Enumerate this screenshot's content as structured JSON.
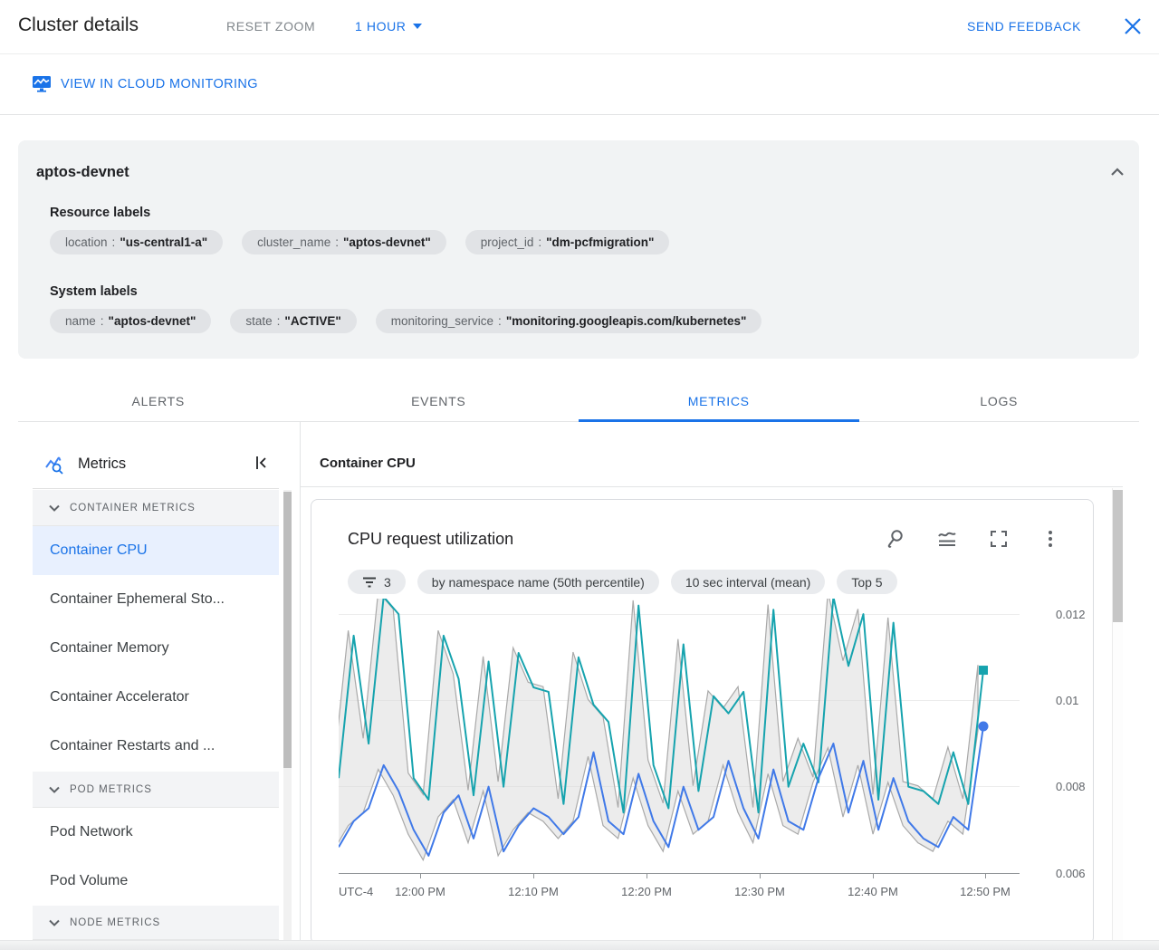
{
  "header": {
    "title": "Cluster details",
    "reset_zoom_label": "RESET ZOOM",
    "time_range_label": "1 HOUR",
    "send_feedback_label": "SEND FEEDBACK"
  },
  "toolbar": {
    "view_in_monitoring_label": "VIEW IN CLOUD MONITORING"
  },
  "cluster_card": {
    "title": "aptos-devnet",
    "resource_labels_title": "Resource labels",
    "resource_labels": [
      {
        "key": "location",
        "value": "\"us-central1-a\""
      },
      {
        "key": "cluster_name",
        "value": "\"aptos-devnet\""
      },
      {
        "key": "project_id",
        "value": "\"dm-pcfmigration\""
      }
    ],
    "system_labels_title": "System labels",
    "system_labels": [
      {
        "key": "name",
        "value": "\"aptos-devnet\""
      },
      {
        "key": "state",
        "value": "\"ACTIVE\""
      },
      {
        "key": "monitoring_service",
        "value": "\"monitoring.googleapis.com/kubernetes\""
      }
    ]
  },
  "tabs": [
    {
      "label": "ALERTS"
    },
    {
      "label": "EVENTS"
    },
    {
      "label": "METRICS"
    },
    {
      "label": "LOGS"
    }
  ],
  "sidebar": {
    "title": "Metrics",
    "sections": [
      {
        "header": "CONTAINER METRICS",
        "items": [
          {
            "label": "Container CPU"
          },
          {
            "label": "Container Ephemeral Sto..."
          },
          {
            "label": "Container Memory"
          },
          {
            "label": "Container Accelerator"
          },
          {
            "label": "Container Restarts and ..."
          }
        ]
      },
      {
        "header": "POD METRICS",
        "items": [
          {
            "label": "Pod Network"
          },
          {
            "label": "Pod Volume"
          }
        ]
      },
      {
        "header": "NODE METRICS",
        "items": []
      }
    ]
  },
  "main": {
    "panel_title": "Container CPU",
    "chart_card": {
      "title": "CPU request utilization",
      "chips": [
        {
          "label": "3",
          "icon": "filter-list-icon"
        },
        {
          "label": "by namespace name (50th percentile)"
        },
        {
          "label": "10 sec interval (mean)"
        },
        {
          "label": "Top 5"
        }
      ]
    }
  },
  "chart_data": {
    "type": "line",
    "title": "CPU request utilization",
    "grid": true,
    "legend_position": "none",
    "x_axis": {
      "timezone_label": "UTC-4",
      "tick_labels": [
        "12:00 PM",
        "12:10 PM",
        "12:20 PM",
        "12:30 PM",
        "12:40 PM",
        "12:50 PM"
      ]
    },
    "y_axis": {
      "tick_labels": [
        "0.012",
        "0.01",
        "0.008",
        "0.006"
      ],
      "tick_values": [
        0.012,
        0.01,
        0.008,
        0.006
      ],
      "range": [
        0.006,
        0.01236
      ],
      "side": "right"
    },
    "band": {
      "fill": "#dcdcdc",
      "edge": "#a9a9a9",
      "meaning": "min-max envelope"
    },
    "series": [
      {
        "name": "teal-series",
        "color": "#16a3ae",
        "marker": "square",
        "values": [
          0.0082,
          0.0115,
          0.009,
          0.0124,
          0.012,
          0.0082,
          0.0077,
          0.0115,
          0.0105,
          0.0078,
          0.0109,
          0.008,
          0.0111,
          0.0103,
          0.0102,
          0.0076,
          0.011,
          0.0099,
          0.0095,
          0.0074,
          0.0122,
          0.0085,
          0.0075,
          0.0113,
          0.0079,
          0.0101,
          0.0097,
          0.0102,
          0.0074,
          0.0121,
          0.008,
          0.009,
          0.0081,
          0.0124,
          0.0108,
          0.012,
          0.0077,
          0.0118,
          0.008,
          0.0079,
          0.0076,
          0.0088,
          0.0076,
          0.0107
        ]
      },
      {
        "name": "blue-series",
        "color": "#4079e8",
        "marker": "circle",
        "values": [
          0.0066,
          0.0072,
          0.0075,
          0.0085,
          0.0079,
          0.007,
          0.0064,
          0.0074,
          0.0078,
          0.0068,
          0.008,
          0.0065,
          0.0071,
          0.0075,
          0.0073,
          0.0069,
          0.0073,
          0.0088,
          0.0072,
          0.0069,
          0.0083,
          0.0072,
          0.0066,
          0.008,
          0.007,
          0.0073,
          0.0086,
          0.0075,
          0.0068,
          0.0084,
          0.0072,
          0.007,
          0.0082,
          0.009,
          0.0074,
          0.0086,
          0.007,
          0.0082,
          0.0072,
          0.0068,
          0.0066,
          0.0073,
          0.007,
          0.0094
        ]
      }
    ]
  }
}
